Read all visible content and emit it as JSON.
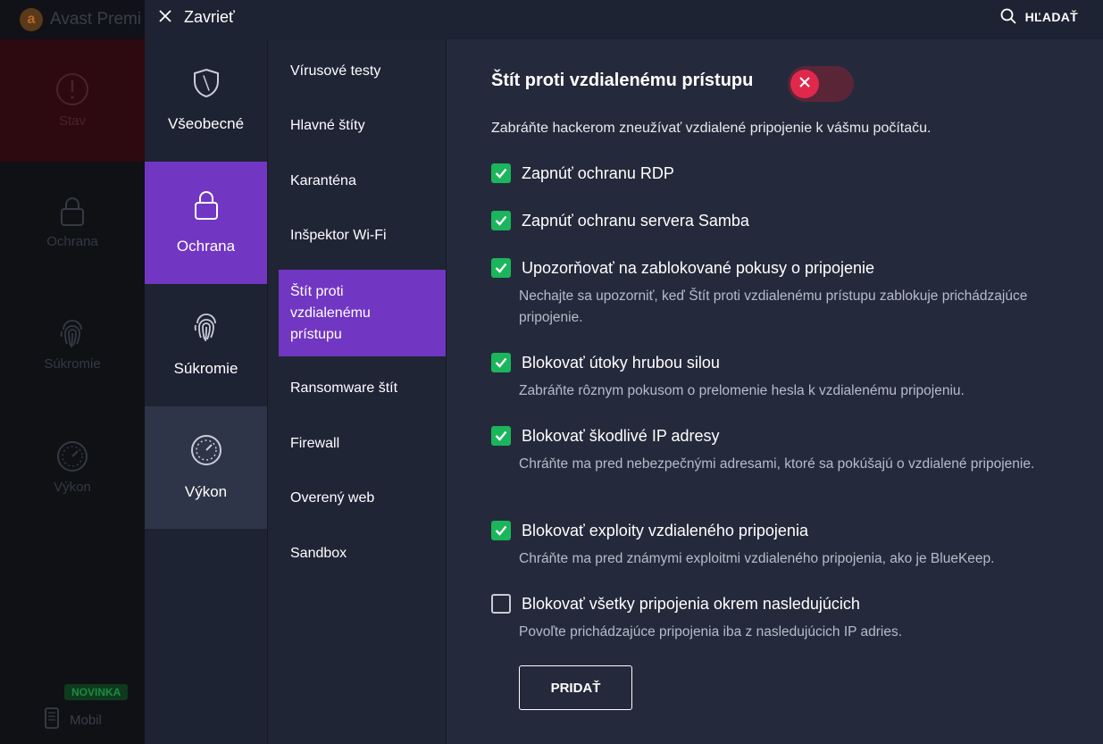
{
  "background_app": {
    "title": "Avast Premi",
    "nav": [
      {
        "label": "Stav",
        "icon": "alert-circle-icon"
      },
      {
        "label": "Ochrana",
        "icon": "lock-icon"
      },
      {
        "label": "Súkromie",
        "icon": "fingerprint-icon"
      },
      {
        "label": "Výkon",
        "icon": "speedometer-icon"
      }
    ],
    "mobile_badge": "NOVINKA",
    "mobile_label": "Mobil"
  },
  "topbar": {
    "close_label": "Zavrieť",
    "search_label": "HĽADAŤ"
  },
  "categories": [
    {
      "label": "Všeobecné",
      "icon": "shield-icon"
    },
    {
      "label": "Ochrana",
      "icon": "lock-icon",
      "active": true
    },
    {
      "label": "Súkromie",
      "icon": "fingerprint-icon"
    },
    {
      "label": "Výkon",
      "icon": "speedometer-icon"
    }
  ],
  "subnav": [
    "Vírusové testy",
    "Hlavné štíty",
    "Karanténa",
    "Inšpektor Wi-Fi",
    "Štít proti vzdialenému prístupu",
    "Ransomware štít",
    "Firewall",
    "Overený web",
    "Sandbox"
  ],
  "subnav_active_lines": [
    "Štít proti",
    "vzdialenému",
    "prístupu"
  ],
  "content": {
    "title": "Štít proti vzdialenému prístupu",
    "toggle_state": "off",
    "description": "Zabráňte hackerom zneužívať vzdialené pripojenie k vášmu počítaču.",
    "options": [
      {
        "label": "Zapnúť ochranu RDP",
        "checked": true,
        "sub": ""
      },
      {
        "label": "Zapnúť ochranu servera Samba",
        "checked": true,
        "sub": ""
      },
      {
        "label": "Upozorňovať na zablokované pokusy o pripojenie",
        "checked": true,
        "sub": "Nechajte sa upozorniť, keď Štít proti vzdialenému prístupu zablokuje prichádzajúce pripojenie."
      },
      {
        "label": "Blokovať útoky hrubou silou",
        "checked": true,
        "sub": "Zabráňte rôznym pokusom o prelomenie hesla k vzdialenému pripojeniu."
      },
      {
        "label": "Blokovať škodlivé IP adresy",
        "checked": true,
        "sub": "Chráňte ma pred nebezpečnými adresami, ktoré sa pokúšajú o vzdialené pripojenie."
      },
      {
        "label": "Blokovať exploity vzdialeného pripojenia",
        "checked": true,
        "sub": "Chráňte ma pred známymi exploitmi vzdialeného pripojenia, ako je BlueKeep."
      },
      {
        "label": "Blokovať všetky pripojenia okrem nasledujúcich",
        "checked": false,
        "sub": "Povoľte prichádzajúce pripojenia iba z nasledujúcich IP adries."
      }
    ],
    "add_button": "PRIDAŤ"
  },
  "colors": {
    "accent": "#7136c2",
    "checkbox": "#1bb55c",
    "toggle_off": "#e0284d",
    "panel": "#242a3b"
  }
}
